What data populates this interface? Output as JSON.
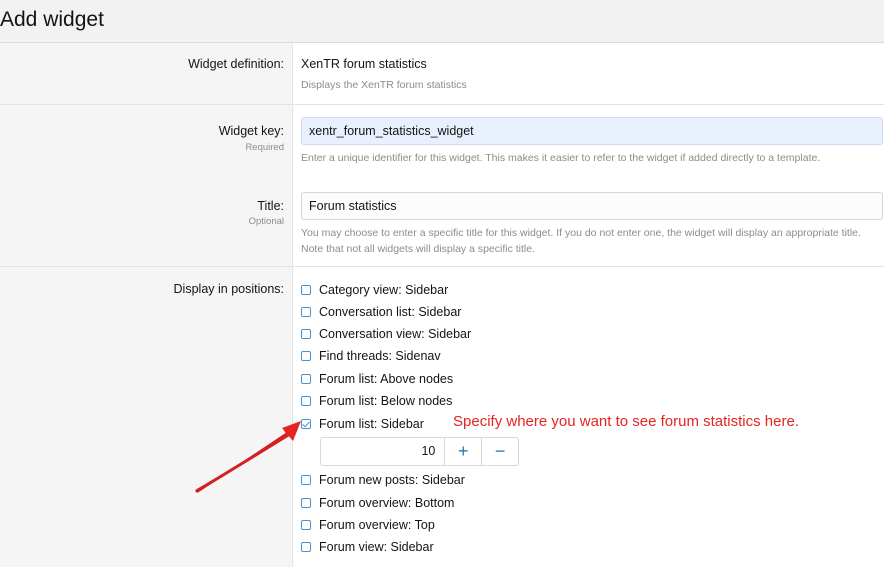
{
  "header": {
    "title": "Add widget"
  },
  "form": {
    "definition": {
      "label": "Widget definition:",
      "value": "XenTR forum statistics",
      "description": "Displays the XenTR forum statistics"
    },
    "widget_key": {
      "label": "Widget key:",
      "sublabel": "Required",
      "value": "xentr_forum_statistics_widget",
      "hint": "Enter a unique identifier for this widget. This makes it easier to refer to the widget if added directly to a template."
    },
    "title": {
      "label": "Title:",
      "sublabel": "Optional",
      "value": "Forum statistics",
      "hint_line1": "You may choose to enter a specific title for this widget. If you do not enter one, the widget will display an appropriate title.",
      "hint_line2": "Note that not all widgets will display a specific title."
    },
    "positions": {
      "label": "Display in positions:",
      "items": [
        {
          "label": "Category view: Sidebar",
          "checked": false
        },
        {
          "label": "Conversation list: Sidebar",
          "checked": false
        },
        {
          "label": "Conversation view: Sidebar",
          "checked": false
        },
        {
          "label": "Find threads: Sidenav",
          "checked": false
        },
        {
          "label": "Forum list: Above nodes",
          "checked": false
        },
        {
          "label": "Forum list: Below nodes",
          "checked": false
        },
        {
          "label": "Forum list: Sidebar",
          "checked": true
        },
        {
          "label": "Forum new posts: Sidebar",
          "checked": false
        },
        {
          "label": "Forum overview: Bottom",
          "checked": false
        },
        {
          "label": "Forum overview: Top",
          "checked": false
        },
        {
          "label": "Forum view: Sidebar",
          "checked": false
        }
      ],
      "order_value": "10",
      "plus_label": "+",
      "minus_label": "−"
    }
  },
  "annotation": {
    "text": "Specify where you want to see forum statistics here.",
    "color": "#e52421"
  },
  "colors": {
    "accent": "#2577b1",
    "checkbox": "#4a93d1",
    "autofill_bg": "#e8f0fe"
  }
}
